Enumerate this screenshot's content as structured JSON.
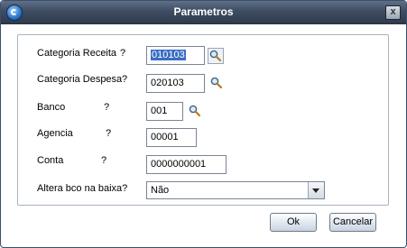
{
  "window": {
    "title": "Parametros",
    "close_label": "x"
  },
  "form": {
    "categoria_receita": {
      "label": "Categoria Receita",
      "help": "?",
      "value": "010103"
    },
    "categoria_despesa": {
      "label": "Categoria Despesa",
      "help": "?",
      "value": "020103"
    },
    "banco": {
      "label": "Banco",
      "help": "?",
      "value": "001"
    },
    "agencia": {
      "label": "Agencia",
      "help": "?",
      "value": "00001"
    },
    "conta": {
      "label": "Conta",
      "help": "?",
      "value": "0000000001"
    },
    "altera_bco": {
      "label": "Altera bco na baixa?",
      "value": "Não"
    }
  },
  "buttons": {
    "ok": "Ok",
    "cancel": "Cancelar"
  },
  "icons": {
    "lookup": "magnifier-icon",
    "app": "app-icon",
    "close": "close-icon",
    "dropdown": "chevron-down-icon"
  }
}
